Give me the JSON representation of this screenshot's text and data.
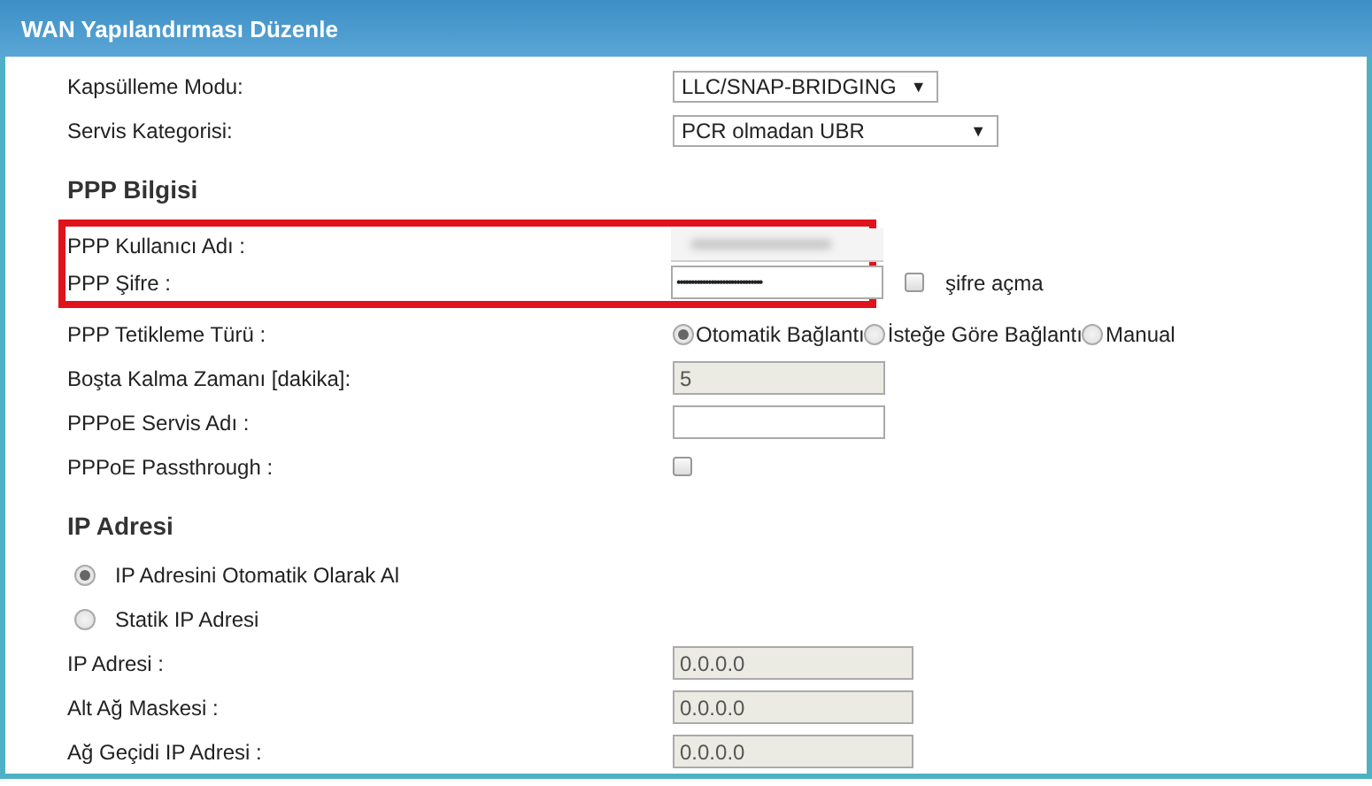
{
  "window": {
    "title": "WAN Yapılandırması Düzenle"
  },
  "rows": [
    {
      "kind": "select",
      "label": "Kapsülleme Modu:",
      "value": "LLC/SNAP-BRIDGING",
      "arrow": "▼",
      "wide": false
    },
    {
      "kind": "select",
      "label": "Servis Kategorisi:",
      "value": "PCR olmadan UBR",
      "arrow": "▼",
      "wide": true
    },
    {
      "kind": "heading",
      "label": "PPP Bilgisi"
    },
    {
      "kind": "blurred",
      "label": "PPP Kullanıcı Adı :",
      "highlighted": true
    },
    {
      "kind": "password",
      "label": "PPP Şifre :",
      "value": "••••••••••••••••••••••••••••••",
      "highlighted": true,
      "toggle": {
        "label": "şifre açma",
        "checked": false
      }
    },
    {
      "kind": "radios",
      "label": "PPP Tetikleme Türü :",
      "options": [
        {
          "label": "Otomatik Bağlantı",
          "selected": true
        },
        {
          "label": "İsteğe Göre Bağlantı",
          "selected": false
        },
        {
          "label": "Manual",
          "selected": false
        }
      ]
    },
    {
      "kind": "text",
      "label": "Boşta Kalma Zamanı [dakika]:",
      "value": "5",
      "disabled": true
    },
    {
      "kind": "text",
      "label": "PPPoE Servis Adı :",
      "disabled": false
    },
    {
      "kind": "checkbox",
      "label": "PPPoE Passthrough :",
      "checked": false
    },
    {
      "kind": "heading",
      "label": "IP Adresi"
    },
    {
      "kind": "option",
      "label": "IP Adresini Otomatik Olarak Al",
      "selected": true
    },
    {
      "kind": "option",
      "label": "Statik IP Adresi",
      "selected": false
    },
    {
      "kind": "text",
      "label": "IP Adresi :",
      "value": "0.0.0.0",
      "disabled": true,
      "short": true
    },
    {
      "kind": "text",
      "label": "Alt Ağ Maskesi :",
      "value": "0.0.0.0",
      "disabled": true,
      "short": true
    },
    {
      "kind": "text",
      "label": "Ağ Geçidi IP Adresi :",
      "value": "0.0.0.0",
      "disabled": true,
      "short": true
    }
  ]
}
